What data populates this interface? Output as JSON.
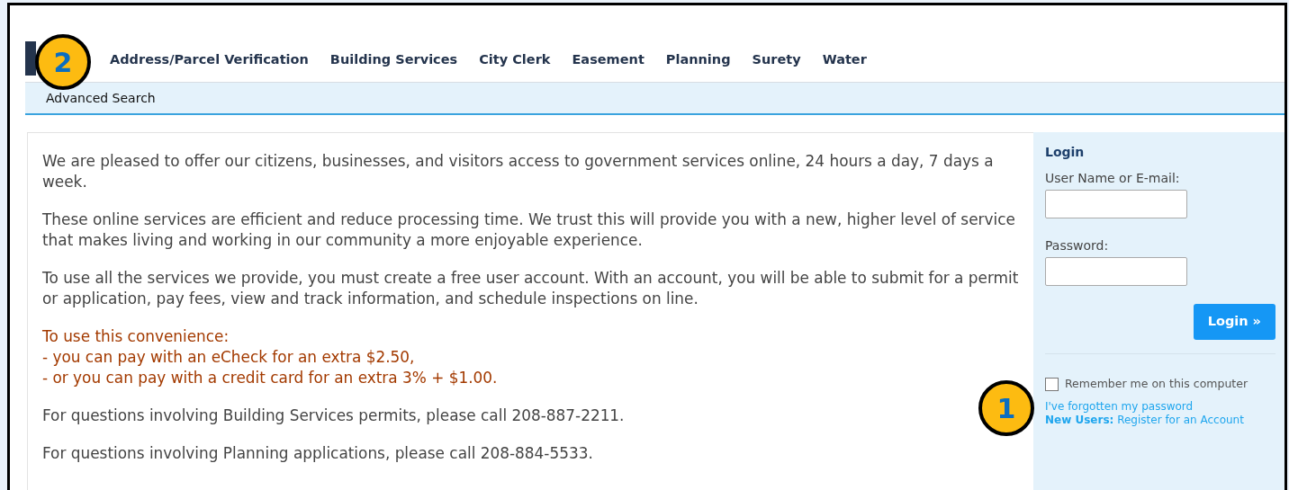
{
  "nav": {
    "tabs": [
      {
        "label": "Address/Parcel Verification"
      },
      {
        "label": "Building Services"
      },
      {
        "label": "City Clerk"
      },
      {
        "label": "Easement"
      },
      {
        "label": "Planning"
      },
      {
        "label": "Surety"
      },
      {
        "label": "Water"
      }
    ]
  },
  "subnav": {
    "links": [
      "Advanced Search"
    ]
  },
  "content": {
    "paragraphs": [
      {
        "kind": "text",
        "text": "We are pleased to offer our citizens, businesses, and visitors access to government services online, 24 hours a day, 7 days a week."
      },
      {
        "kind": "text",
        "text": "These online services are efficient and reduce processing time.  We trust this will provide you with a new, higher level of service that makes living and working in our community a more enjoyable experience."
      },
      {
        "kind": "text",
        "text": "To use all the services we provide, you must create a free user account. With an account, you will be able to submit for a permit or application, pay fees, view and track information, and schedule inspections on line."
      },
      {
        "kind": "notice",
        "lines": [
          "To use this convenience:",
          "- you can pay with an eCheck for an extra $2.50,",
          "- or you can pay with a credit card for an extra 3% + $1.00."
        ]
      },
      {
        "kind": "text",
        "text": "For questions involving Building Services permits, please call 208-887-2211."
      },
      {
        "kind": "text",
        "text": "For questions involving Planning applications, please call 208-884-5533."
      }
    ]
  },
  "login": {
    "title": "Login",
    "fields": [
      {
        "label": "User Name or E-mail:"
      },
      {
        "label": "Password:"
      }
    ],
    "button": "Login »",
    "remember": {
      "label": "Remember me on this computer",
      "checked": false
    },
    "links": [
      "I've forgotten my password",
      "**New Users:** Register for an Account"
    ]
  },
  "callouts": [
    {
      "number": "2"
    },
    {
      "number": "1"
    }
  ]
}
